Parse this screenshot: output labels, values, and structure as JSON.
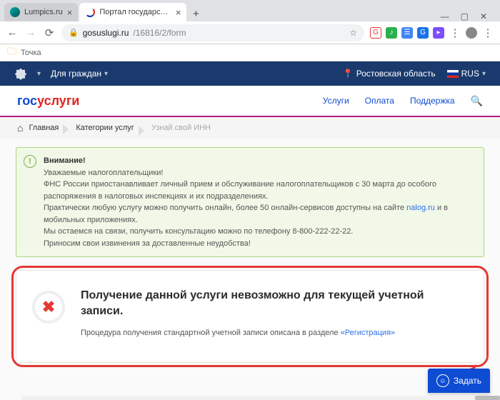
{
  "browser": {
    "tabs": [
      {
        "title": "Lumpics.ru",
        "active": false
      },
      {
        "title": "Портал государственных услуг",
        "active": true
      }
    ],
    "newtab_glyph": "+",
    "win": {
      "min": "—",
      "max": "▢",
      "close": "✕"
    },
    "nav": {
      "back": "←",
      "forward": "→",
      "reload": "⟳"
    },
    "url": {
      "lock": "🔒",
      "domain": "gosuslugi.ru",
      "path": "/16816/2/form",
      "star": "☆"
    },
    "bookmark": "Точка"
  },
  "topnav": {
    "audience": "Для граждан",
    "region": "Ростовская область",
    "lang": "RUS"
  },
  "header": {
    "logo_pre": "гос",
    "logo_mid": "услуги",
    "links": [
      "Услуги",
      "Оплата",
      "Поддержка"
    ]
  },
  "crumbs": [
    "Главная",
    "Категории услуг",
    "Узнай свой ИНН"
  ],
  "notice": {
    "title": "Внимание!",
    "l1": "Уважаемые налогоплательщики!",
    "l2": "ФНС России приостанавливает личный прием и обслуживание налогоплательщиков с 30 марта до особого распоряжения в налоговых инспекциях и их подразделениях.",
    "l3a": "Практически любую услугу можно получить онлайн, более 50 онлайн-сервисов доступны на сайте ",
    "l3link": "nalog.ru",
    "l3b": " и в мобильных приложениях.",
    "l4": "Мы остаемся на связи, получить консультацию можно по телефону 8-800-222-22-22.",
    "l5": "Приносим свои извинения за доставленные неудобства!"
  },
  "block": {
    "title": "Получение данной услуги невозможно для текущей учетной записи.",
    "sub_pre": "Процедура получения стандартной учетной записи описана в разделе ",
    "sub_link": "«Регистрация»"
  },
  "ask_button": "Задать"
}
